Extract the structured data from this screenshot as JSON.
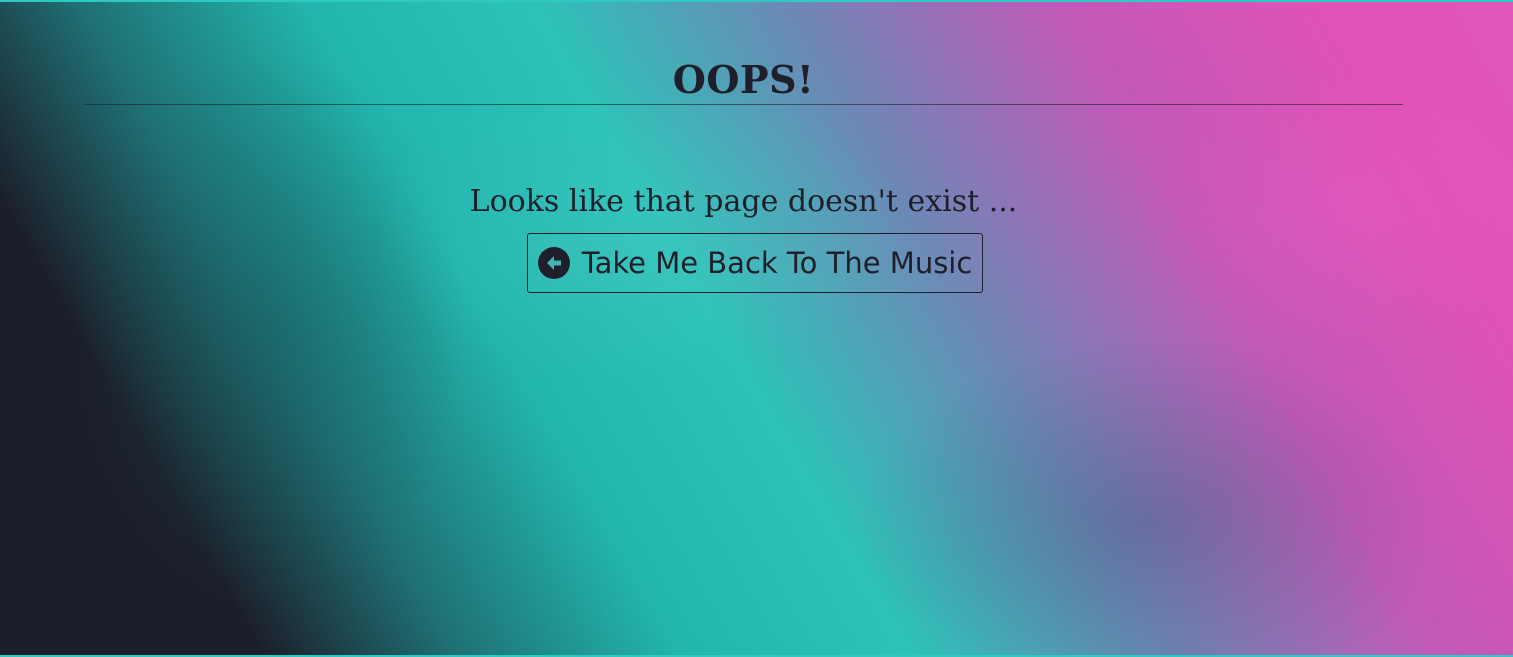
{
  "page": {
    "title": "OOPS!",
    "message": "Looks like that page doesn't exist ...",
    "back_button": {
      "label": "Take Me Back To The Music",
      "icon": "arrow-circle-left-icon"
    }
  },
  "colors": {
    "text": "#1e1f2a",
    "teal": "#2cc3b8",
    "pink": "#e052b6",
    "dark": "#1c1f2b"
  }
}
